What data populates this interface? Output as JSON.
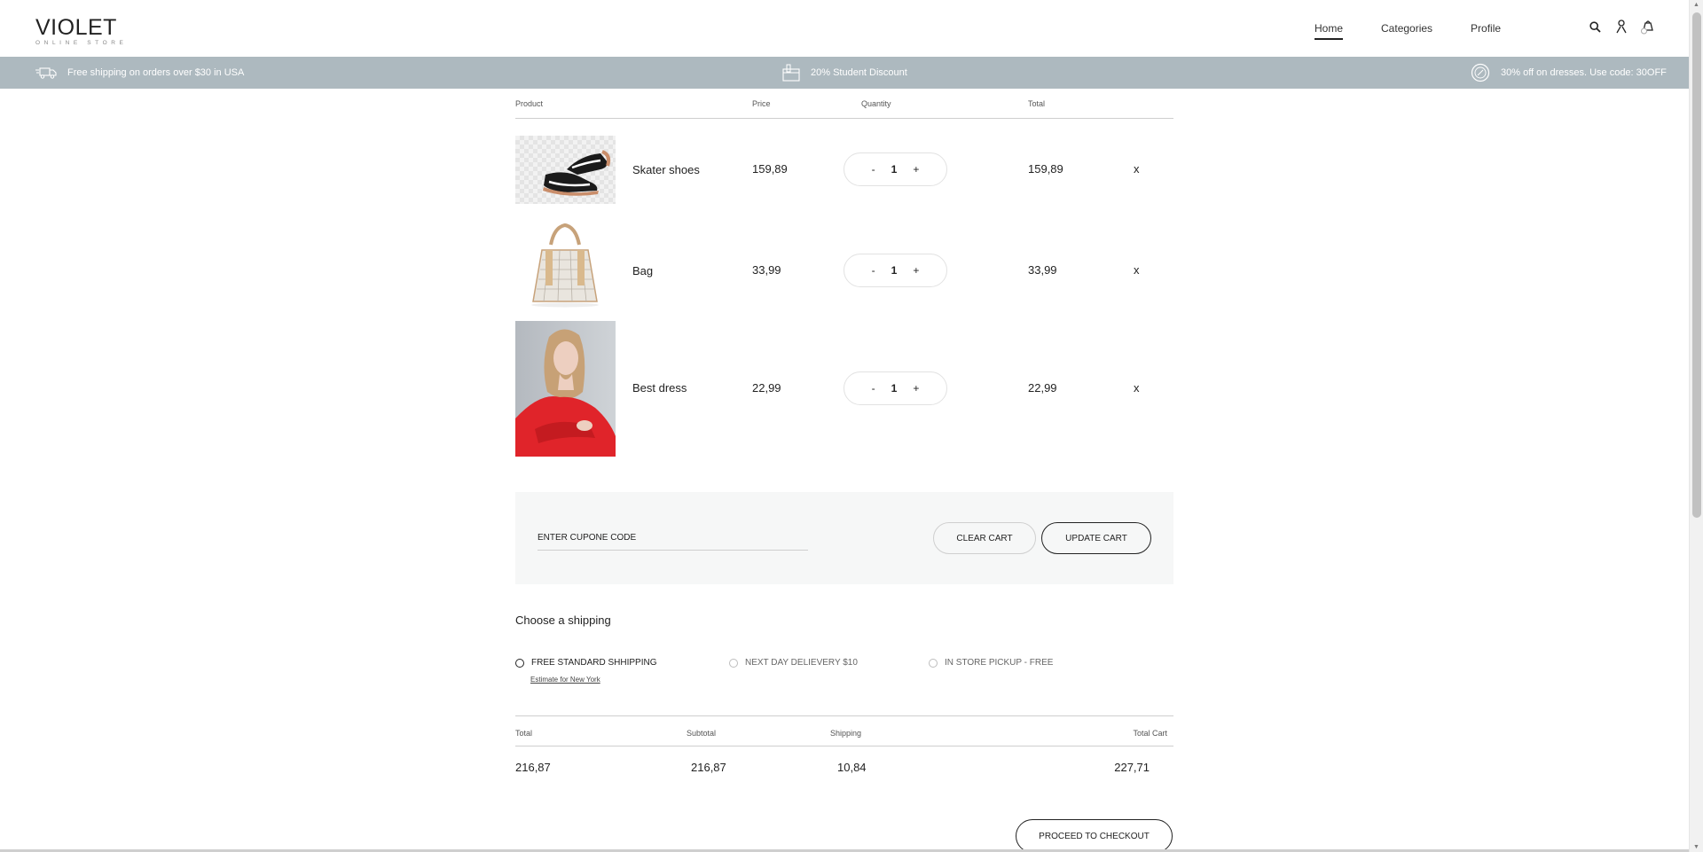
{
  "brand": {
    "name": "VIOLET",
    "tagline": "ONLINE STORE"
  },
  "nav": {
    "home": "Home",
    "categories": "Categories",
    "profile": "Profile"
  },
  "header_icons": [
    "search-icon",
    "user-icon",
    "bag-icon"
  ],
  "promo": {
    "shipping": "Free shipping on orders over $30 in USA",
    "student": "20% Student Discount",
    "dresses": "30% off on dresses. Use code: 30OFF"
  },
  "cart": {
    "headers": {
      "product": "Product",
      "price": "Price",
      "quantity": "Quantity",
      "total": "Total"
    },
    "items": [
      {
        "name": "Skater shoes",
        "price": "159,89",
        "qty_minus": "-",
        "qty": "1",
        "qty_plus": "+",
        "total": "159,89",
        "remove": "x"
      },
      {
        "name": "Bag",
        "price": "33,99",
        "qty_minus": "-",
        "qty": "1",
        "qty_plus": "+",
        "total": "33,99",
        "remove": "x"
      },
      {
        "name": "Best dress",
        "price": "22,99",
        "qty_minus": "-",
        "qty": "1",
        "qty_plus": "+",
        "total": "22,99",
        "remove": "x"
      }
    ]
  },
  "coupon": {
    "placeholder": "ENTER CUPONE CODE",
    "clear": "CLEAR CART",
    "update": "UPDATE CART"
  },
  "shipping": {
    "title": "Choose a shipping",
    "options": [
      "FREE STANDARD SHHIPPING",
      "NEXT DAY DELIEVERY $10",
      "IN STORE PICKUP - FREE"
    ],
    "selected": 0,
    "estimate": "Estimate for New York"
  },
  "summary": {
    "headers": {
      "total": "Total",
      "subtotal": "Subtotal",
      "shipping": "Shipping",
      "total_cart": "Total Cart"
    },
    "values": {
      "total": "216,87",
      "subtotal": "216,87",
      "shipping": "10,84",
      "total_cart": "227,71"
    }
  },
  "checkout": "PROCEED TO CHECKOUT",
  "colors": {
    "promo_bar": "#adb9bf",
    "panel": "#f6f7f7",
    "text": "#222222",
    "dress_red": "#e0242a"
  }
}
